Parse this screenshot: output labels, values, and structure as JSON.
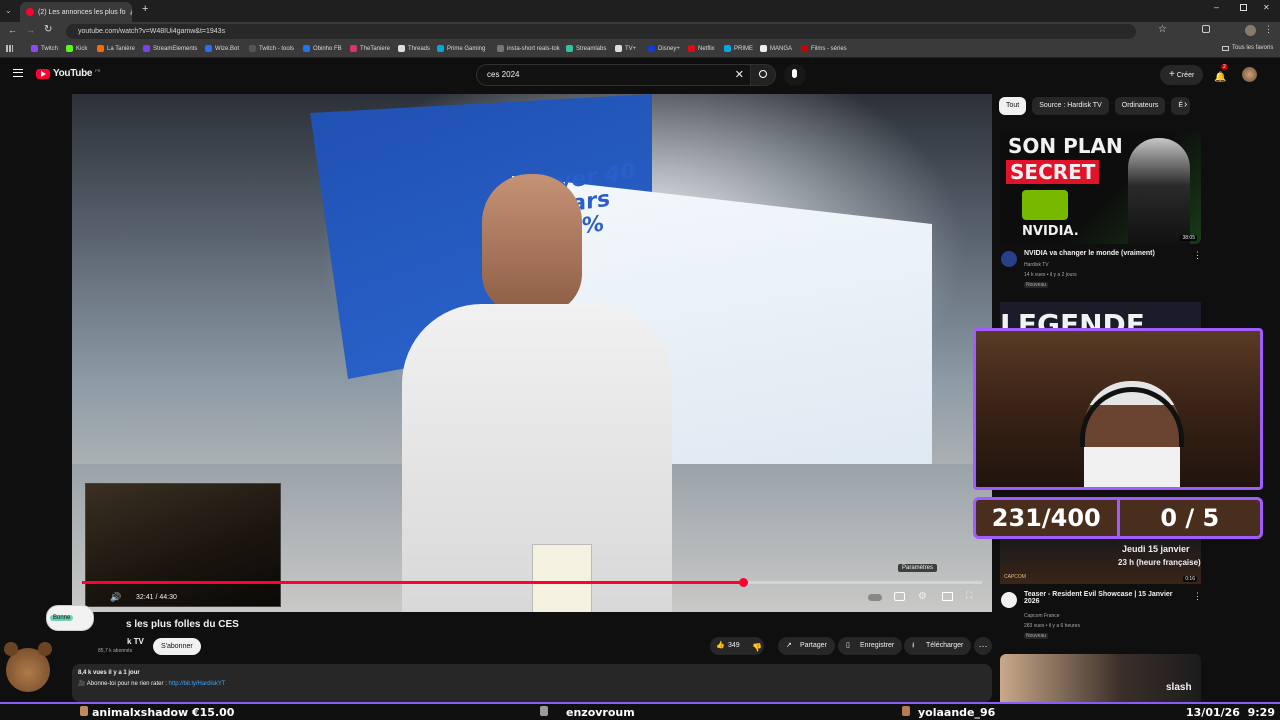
{
  "browser": {
    "tab_title": "(2) Les annonces les plus fo",
    "url": "youtube.com/watch?v=W48IUi4gamw&t=1943s",
    "bookmarks": [
      {
        "label": "Twitch",
        "color": "#9146ff"
      },
      {
        "label": "Kick",
        "color": "#53fc18"
      },
      {
        "label": "La Tanière",
        "color": "#ff6a00"
      },
      {
        "label": "StreamElements",
        "color": "#7b3ff2"
      },
      {
        "label": "Wize.Bot",
        "color": "#2a6cff"
      },
      {
        "label": "Twitch - tools",
        "color": "#555555"
      },
      {
        "label": "Obinho FB",
        "color": "#1877f2"
      },
      {
        "label": "TheTaniere",
        "color": "#e1306c"
      },
      {
        "label": "Threads",
        "color": "#dddddd"
      },
      {
        "label": "Prime Gaming",
        "color": "#00a8e1"
      },
      {
        "label": "insta-short reals-tok",
        "color": "#777777"
      },
      {
        "label": "Streamlabs",
        "color": "#31c3a2"
      },
      {
        "label": "TV+",
        "color": "#dddddd"
      },
      {
        "label": "Disney+",
        "color": "#113ccf"
      },
      {
        "label": "Netflix",
        "color": "#e50914"
      },
      {
        "label": "PRIME",
        "color": "#00a8e1"
      },
      {
        "label": "MANGA",
        "color": "#eeeeee"
      },
      {
        "label": "Films - séries",
        "color": "#cc0000"
      }
    ],
    "all_favorites": "Tous les favoris"
  },
  "youtube": {
    "logo": "YouTube",
    "logo_region": "FR",
    "search_value": "ces 2024",
    "create_label": "Créer",
    "notification_count": "2"
  },
  "player": {
    "time": "32:41 / 44:30",
    "progress": 0.734,
    "settings_tooltip": "Paramètres"
  },
  "video": {
    "title": "s les plus folles du CES",
    "channel": "k TV",
    "subscribers": "85,7 k abonnés",
    "subscribe_label": "S'abonner",
    "likes": "349",
    "share_label": "Partager",
    "save_label": "Enregistrer",
    "download_label": "Télécharger",
    "views_line": "8,4 k vues  il y a 1 jour",
    "desc_line": "🎥 Abonne-toi pour ne rien rater : ",
    "desc_link": "http://bit.ly/HardiskYT",
    "badge_pill": "Bonne"
  },
  "sidebar": {
    "chips": [
      "Tout",
      "Source : Hardisk TV",
      "Ordinateurs",
      "É"
    ],
    "cards": [
      {
        "thumb_lines": [
          "SON PLAN",
          "SECRET",
          "NVIDIA."
        ],
        "duration": "38:05",
        "title": "NVIDIA va changer le monde (vraiment)",
        "channel": "Hardisk TV",
        "meta": "14 k vues • il y a 2 jours",
        "badge": "Nouveau"
      },
      {
        "thumb_lines": [
          "LEGENDE"
        ],
        "duration": "",
        "title": "",
        "channel": "",
        "meta": "",
        "badge": ""
      },
      {
        "thumb_lines": [
          "Jeudi 15 janvier",
          "23 h (heure française)",
          "CAPCOM"
        ],
        "duration": "0:16",
        "title": "Teaser - Resident Evil Showcase | 15 Janvier 2026",
        "channel": "Capcom France",
        "meta": "283 vues • il y a 6 heures",
        "badge": "Nouveau"
      },
      {
        "thumb_lines": [
          "slash"
        ],
        "duration": "",
        "title": "",
        "channel": "",
        "meta": "",
        "badge": ""
      }
    ]
  },
  "overlay": {
    "counter_left": "231/400",
    "counter_right": "0 / 5",
    "ticker_left": "animalxshadow €15.00",
    "ticker_mid": "enzovroum",
    "ticker_right": "yolaande_96",
    "datetime": "13/01/26  9:29"
  },
  "colors": {
    "yt_red": "#ff0033",
    "overlay_purple": "#a05cff"
  }
}
